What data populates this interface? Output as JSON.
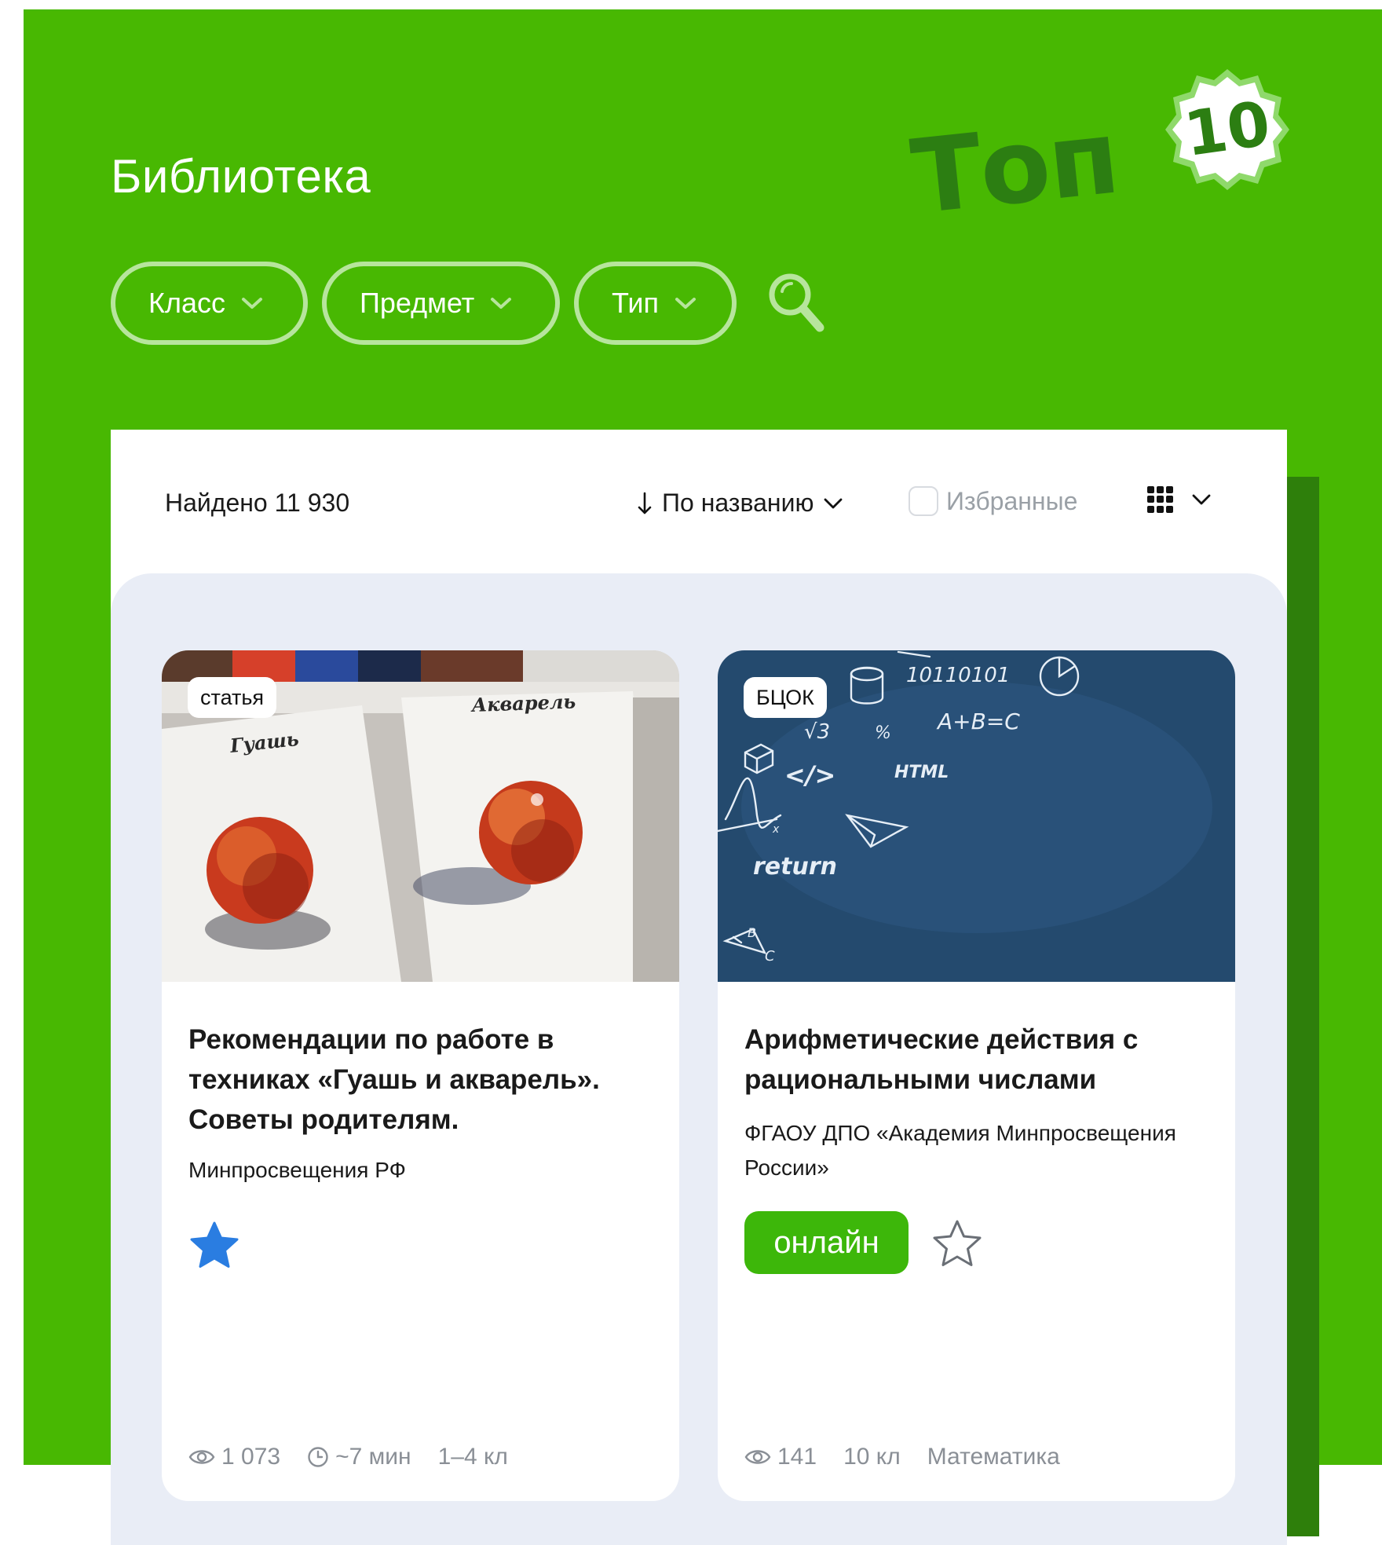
{
  "header": {
    "title": "Библиотека",
    "promo": {
      "word": "Топ",
      "number": "10"
    }
  },
  "filters": [
    {
      "label": "Класс"
    },
    {
      "label": "Предмет"
    },
    {
      "label": "Тип"
    }
  ],
  "toolbar": {
    "found_text": "Найдено 11 930",
    "sort_label": "По названию",
    "favorites_label": "Избранные",
    "favorites_checked": false
  },
  "cards": [
    {
      "type_tag": "статья",
      "title": "Рекомендации по работе в техниках «Гуашь и акварель». Советы родителям.",
      "organization": "Минпросвещения РФ",
      "favorited": true,
      "image_labels": [
        "Гуашь",
        "Акварель"
      ],
      "meta": {
        "views": "1 073",
        "time": "~7 мин",
        "grades": "1–4 кл"
      }
    },
    {
      "type_tag": "БЦОК",
      "title": "Арифметические действия с рациональными числами",
      "organization": "ФГАОУ ДПО «Академия Минпросвещения России»",
      "online_label": "онлайн",
      "favorited": false,
      "image_labels": [
        "10110101",
        "A+B=C",
        "√3",
        "%",
        "</>",
        "HTML",
        "return",
        "B",
        "C",
        "x"
      ],
      "meta": {
        "views": "141",
        "grades": "10 кл",
        "subject": "Математика"
      }
    }
  ],
  "colors": {
    "brand_green": "#48b802",
    "dark_green": "#2e7f0b",
    "pill_border": "#b7e59d",
    "online_green": "#3db70a",
    "star_blue": "#2a7de1",
    "panel_bg": "#e9edf6",
    "muted_text": "#8a8f96"
  },
  "icons": {
    "filter_chevron": "chevron-down-icon",
    "search": "search-icon",
    "sort_arrow": "arrow-down-icon",
    "view_grid": "grid-icon",
    "favorite_filled": "star-filled-icon",
    "favorite_empty": "star-outline-icon",
    "views": "eye-icon",
    "time": "clock-icon"
  }
}
